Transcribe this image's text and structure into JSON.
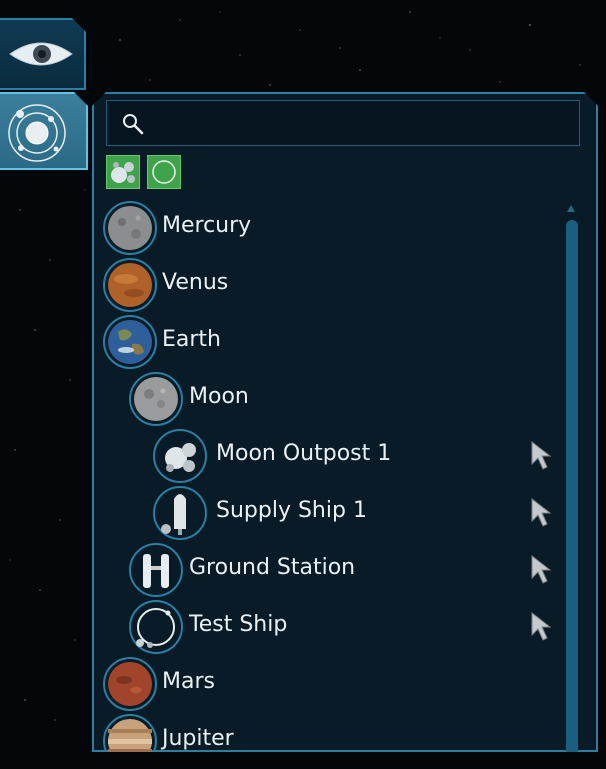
{
  "search": {
    "value": "",
    "placeholder": ""
  },
  "filters": [
    {
      "icon": "celestial-bodies-icon",
      "color": "#3ea34a"
    },
    {
      "icon": "orbit-circle-icon",
      "color": "#3ea34a"
    }
  ],
  "side_tabs": [
    {
      "icon": "eye-icon",
      "active": false
    },
    {
      "icon": "solar-system-icon",
      "active": true
    }
  ],
  "objects": [
    {
      "label": "Mercury",
      "icon": "mercury-icon",
      "depth": 0,
      "selectable": false
    },
    {
      "label": "Venus",
      "icon": "venus-icon",
      "depth": 0,
      "selectable": false
    },
    {
      "label": "Earth",
      "icon": "earth-icon",
      "depth": 0,
      "selectable": false
    },
    {
      "label": "Moon",
      "icon": "moon-icon",
      "depth": 1,
      "selectable": false
    },
    {
      "label": "Moon Outpost 1",
      "icon": "outpost-icon",
      "depth": 2,
      "selectable": true
    },
    {
      "label": "Supply Ship 1",
      "icon": "ship-icon",
      "depth": 2,
      "selectable": true
    },
    {
      "label": "Ground Station",
      "icon": "station-icon",
      "depth": 1,
      "selectable": true
    },
    {
      "label": "Test Ship",
      "icon": "test-ship-icon",
      "depth": 1,
      "selectable": true
    },
    {
      "label": "Mars",
      "icon": "mars-icon",
      "depth": 0,
      "selectable": false
    },
    {
      "label": "Jupiter",
      "icon": "jupiter-icon",
      "depth": 0,
      "selectable": false
    }
  ],
  "colors": {
    "panel_border": "#2d7fa2",
    "accent": "#5fc2e6",
    "filter_green": "#3ea34a",
    "text": "#e9f1f5"
  }
}
